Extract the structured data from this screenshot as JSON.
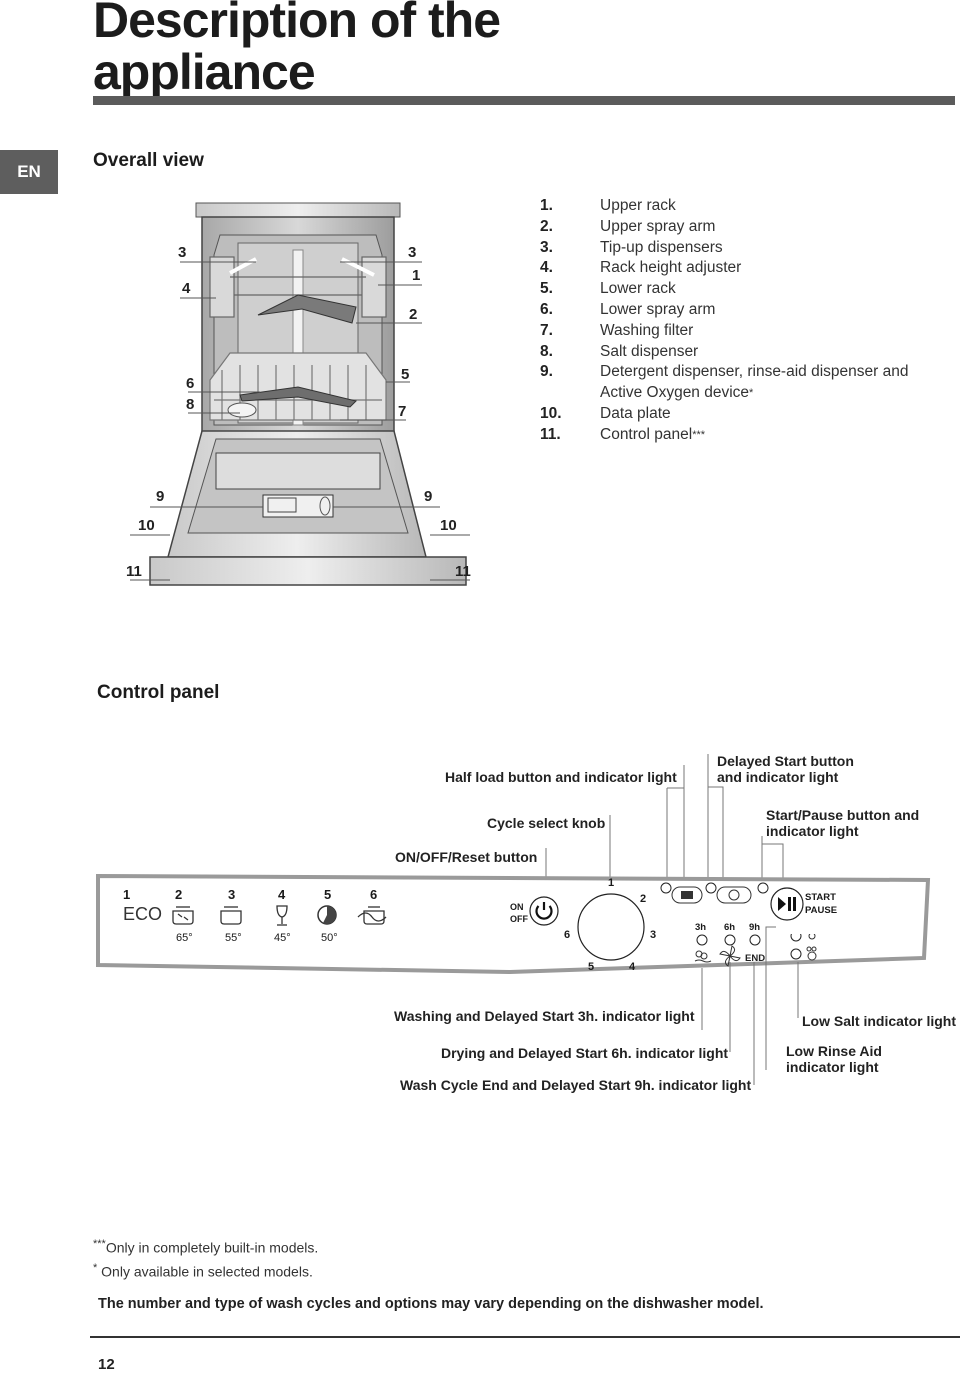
{
  "header": {
    "title_line1": "Description of the",
    "title_line2": "appliance",
    "language_tab": "EN"
  },
  "overall_view": {
    "heading": "Overall view",
    "legend": [
      {
        "num": "1.",
        "label": "Upper rack"
      },
      {
        "num": "2.",
        "label": "Upper spray arm"
      },
      {
        "num": "3.",
        "label": "Tip-up dispensers"
      },
      {
        "num": "4.",
        "label": "Rack height adjuster"
      },
      {
        "num": "5.",
        "label": "Lower rack"
      },
      {
        "num": "6.",
        "label": "Lower spray arm"
      },
      {
        "num": "7.",
        "label": "Washing filter"
      },
      {
        "num": "8.",
        "label": "Salt dispenser"
      },
      {
        "num": "9.",
        "label": "Detergent dispenser, rinse-aid dispenser and",
        "label2": "Active Oxygen device",
        "sup": "*"
      },
      {
        "num": "10.",
        "label": "Data plate"
      },
      {
        "num": "11.",
        "label": "Control panel",
        "sup": "***"
      }
    ],
    "diagram_callouts": {
      "left": [
        "3",
        "4",
        "6",
        "8",
        "9",
        "10",
        "11"
      ],
      "right": [
        "3",
        "1",
        "2",
        "5",
        "7",
        "9",
        "10",
        "11"
      ]
    }
  },
  "control_panel": {
    "heading": "Control panel",
    "callouts_top": {
      "half_load": "Half load button and indicator light",
      "delayed_start_1": "Delayed Start button",
      "delayed_start_2": "and indicator light",
      "cycle_knob": "Cycle select knob",
      "start_pause_1": "Start/Pause button and",
      "start_pause_2": "indicator light",
      "on_off": "ON/OFF/Reset button"
    },
    "callouts_bottom": {
      "washing": "Washing and Delayed Start 3h. indicator light",
      "drying": "Drying and Delayed Start 6h. indicator light",
      "end": "Wash Cycle End and Delayed Start 9h. indicator light",
      "low_salt": "Low Salt indicator light",
      "low_rinse_1": "Low Rinse Aid",
      "low_rinse_2": "indicator light"
    },
    "programs": [
      {
        "num": "1",
        "icon": "eco-text",
        "label": "ECO",
        "temp": ""
      },
      {
        "num": "2",
        "icon": "pot-intensive-icon",
        "label": "",
        "temp": "65°"
      },
      {
        "num": "3",
        "icon": "pot-normal-icon",
        "label": "",
        "temp": "55°"
      },
      {
        "num": "4",
        "icon": "wine-glass-icon",
        "label": "",
        "temp": "45°"
      },
      {
        "num": "5",
        "icon": "rapid-clock-icon",
        "label": "",
        "temp": "50°"
      },
      {
        "num": "6",
        "icon": "soak-pot-icon",
        "label": "",
        "temp": ""
      }
    ],
    "on_label": "ON",
    "off_label": "OFF",
    "knob_numbers": [
      "1",
      "2",
      "3",
      "4",
      "5",
      "6"
    ],
    "delay_labels": [
      "3h",
      "6h",
      "9h"
    ],
    "end_label": "END",
    "start_label": "START",
    "pause_label": "PAUSE"
  },
  "footnotes": {
    "triple_star_mark": "***",
    "triple_star_text": "Only in completely built-in models.",
    "single_star_mark": "*",
    "single_star_text": " Only available in selected models.",
    "note": "The number and type of wash cycles and options may vary depending on the dishwasher model."
  },
  "page_number": "12"
}
